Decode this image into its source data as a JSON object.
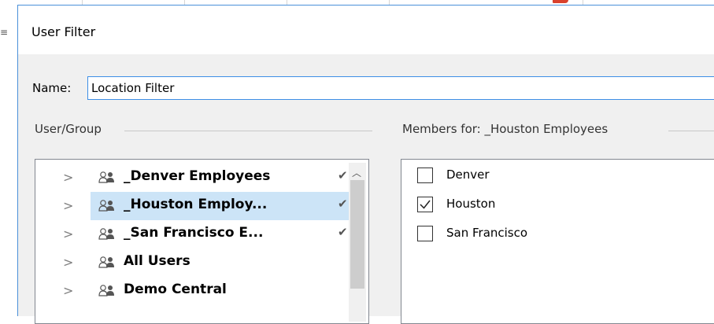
{
  "window": {
    "title": "User Filter"
  },
  "name_field": {
    "label": "Name:",
    "value": "Location Filter"
  },
  "user_group": {
    "label": "User/Group",
    "items": [
      {
        "label": "_Denver Employees",
        "checked": true,
        "selected": false,
        "icon": "users-icon"
      },
      {
        "label": "_Houston Employ...",
        "checked": true,
        "selected": true,
        "icon": "users-icon"
      },
      {
        "label": "_San Francisco E...",
        "checked": true,
        "selected": false,
        "icon": "users-icon"
      },
      {
        "label": "All Users",
        "checked": false,
        "selected": false,
        "icon": "users-icon"
      },
      {
        "label": "Demo Central",
        "checked": false,
        "selected": false,
        "icon": "users-icon"
      }
    ]
  },
  "members": {
    "label": "Members for: _Houston Employees",
    "items": [
      {
        "label": "Denver",
        "checked": false
      },
      {
        "label": "Houston",
        "checked": true
      },
      {
        "label": "San Francisco",
        "checked": false
      }
    ]
  },
  "colors": {
    "accent": "#3d8ee6",
    "selection": "#cce4f7",
    "dialog_bg": "#f0f0f0",
    "red_mark": "#d9412c"
  }
}
